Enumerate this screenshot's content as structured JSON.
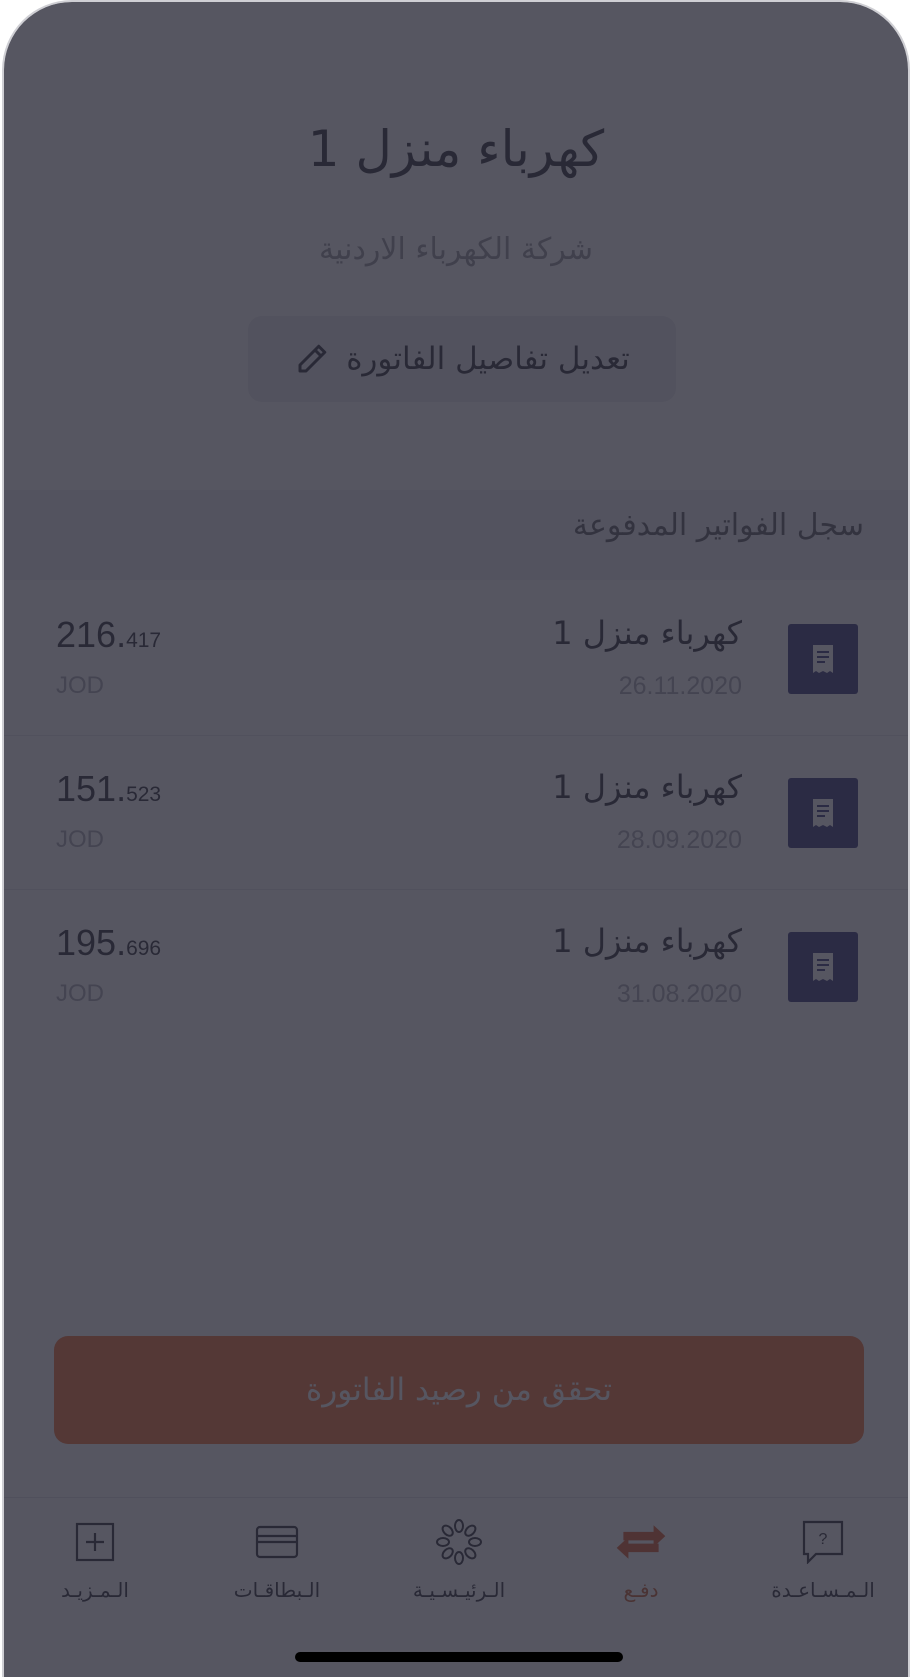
{
  "bill": {
    "title": "كهرباء منزل 1",
    "company": "شركة الكهرباء الاردنية",
    "edit_label": "تعديل تفاصيل الفاتورة"
  },
  "history": {
    "title": "سجل الفواتير المدفوعة",
    "items": [
      {
        "name": "كهرباء منزل 1",
        "date": "26.11.2020",
        "amount_int": "216.",
        "amount_dec": "417",
        "currency": "JOD"
      },
      {
        "name": "كهرباء منزل 1",
        "date": "28.09.2020",
        "amount_int": "151.",
        "amount_dec": "523",
        "currency": "JOD"
      },
      {
        "name": "كهرباء منزل 1",
        "date": "31.08.2020",
        "amount_int": "195.",
        "amount_dec": "696",
        "currency": "JOD"
      }
    ]
  },
  "cta": {
    "label": "تحقق من رصيد الفاتورة"
  },
  "nav": {
    "items": [
      {
        "label": "الـمـزيـد",
        "icon": "plus-square-icon"
      },
      {
        "label": "الـبطاقـات",
        "icon": "card-icon"
      },
      {
        "label": "الـرئيـسـيـة",
        "icon": "home-logo-icon"
      },
      {
        "label": "دفـع",
        "icon": "transfer-arrows-icon"
      },
      {
        "label": "الـمـسـاعـدة",
        "icon": "help-icon"
      }
    ],
    "active_index": 3
  },
  "colors": {
    "accent": "#f26a2c",
    "icon_bg": "#2c2870",
    "nav_active": "#c0531f"
  }
}
